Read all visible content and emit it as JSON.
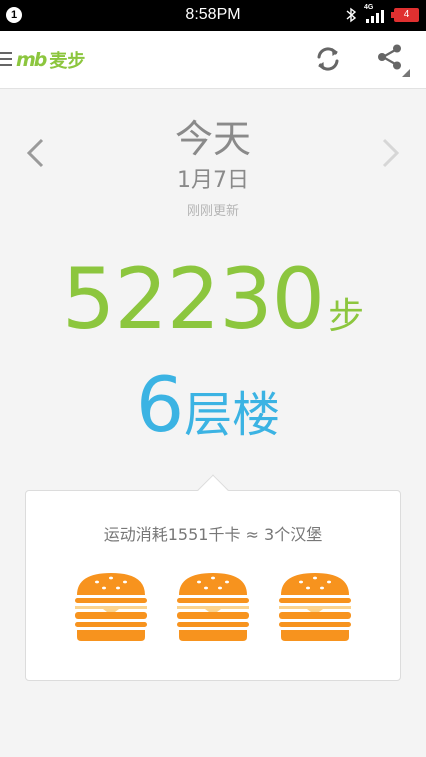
{
  "status_bar": {
    "notification_count": "1",
    "time": "8:58PM",
    "network": "4G",
    "battery": "4"
  },
  "app_bar": {
    "logo_mark": "mb",
    "logo_text": "麦步"
  },
  "day": {
    "title": "今天",
    "date": "1月7日",
    "updated": "刚刚更新"
  },
  "steps": {
    "value": "52230",
    "unit": "步"
  },
  "floors": {
    "value": "6",
    "unit": "层楼"
  },
  "calories_card": {
    "text": "运动消耗1551千卡 ≈ 3个汉堡",
    "burger_count": 3
  },
  "colors": {
    "accent_green": "#8cc63e",
    "accent_blue": "#3bb3e3",
    "burger_orange": "#f7931e"
  }
}
